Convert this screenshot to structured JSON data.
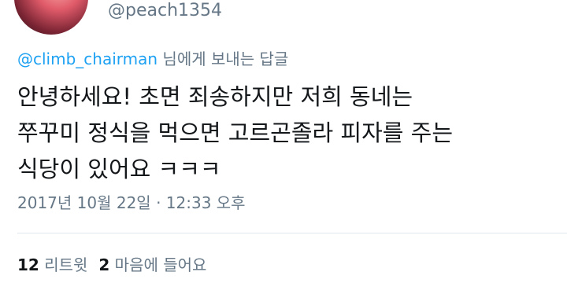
{
  "user": {
    "handle": "@peach1354"
  },
  "reply": {
    "mention": "@climb_chairman",
    "suffix": " 님에게 보내는 답글"
  },
  "tweet": {
    "lines": [
      "안녕하세요! 초면 죄송하지만 저희 동네는",
      "쭈꾸미 정식을 먹으면 고르곤졸라 피자를 주는",
      "식당이 있어요 ㅋㅋㅋ"
    ],
    "timestamp": "2017년 10월 22일 · 12:33 오후"
  },
  "stats": {
    "retweets_count": "12",
    "retweets_label": " 리트윗",
    "likes_count": "2",
    "likes_label": " 마음에 들어요"
  }
}
